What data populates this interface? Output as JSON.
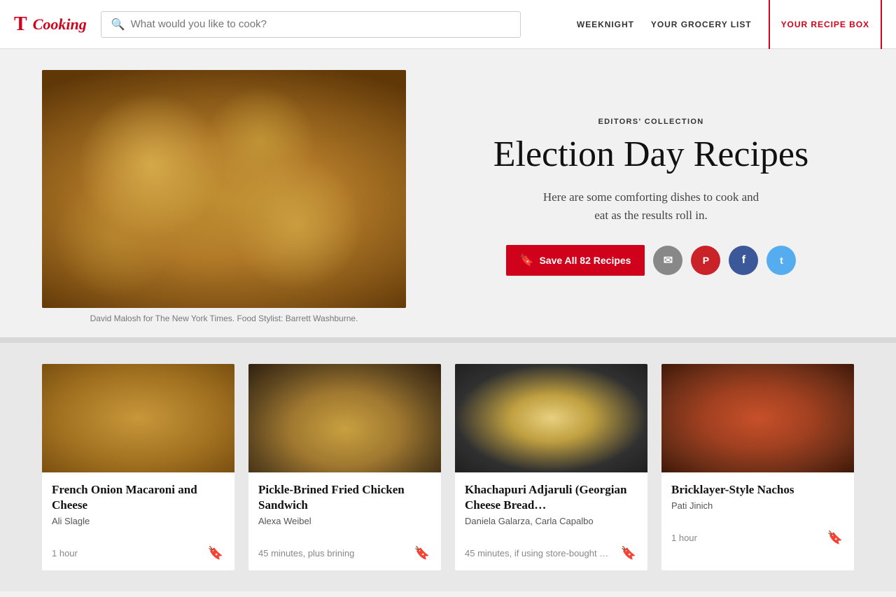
{
  "header": {
    "logo_t": "T",
    "logo_cooking": "Cooking",
    "search_placeholder": "What would you like to cook?",
    "nav": {
      "weeknight": "WEEKNIGHT",
      "grocery_list": "YOUR GROCERY LIST",
      "recipe_box": "YOUR RECIPE BOX"
    }
  },
  "hero": {
    "editors_label": "EDITORS' COLLECTION",
    "title": "Election Day Recipes",
    "subtitle": "Here are some comforting dishes to cook and eat as the results roll in.",
    "save_button": "Save All 82 Recipes",
    "caption": "David Malosh for The New York Times. Food Stylist: Barrett Washburne.",
    "social": {
      "email": "✉",
      "pinterest": "P",
      "facebook": "f",
      "twitter": "t"
    }
  },
  "recipes": [
    {
      "title": "French Onion Macaroni and Cheese",
      "author": "Ali Slagle",
      "time": "1 hour",
      "image_class": "img-macaroni"
    },
    {
      "title": "Pickle-Brined Fried Chicken Sandwich",
      "author": "Alexa Weibel",
      "time": "45 minutes, plus brining",
      "image_class": "img-sandwich"
    },
    {
      "title": "Khachapuri Adjaruli (Georgian Cheese Bread…",
      "author": "Daniela Galarza, Carla Capalbo",
      "time": "45 minutes, if using store-bought …",
      "image_class": "img-khachapuri"
    },
    {
      "title": "Bricklayer-Style Nachos",
      "author": "Pati Jinich",
      "time": "1 hour",
      "image_class": "img-nachos"
    }
  ]
}
